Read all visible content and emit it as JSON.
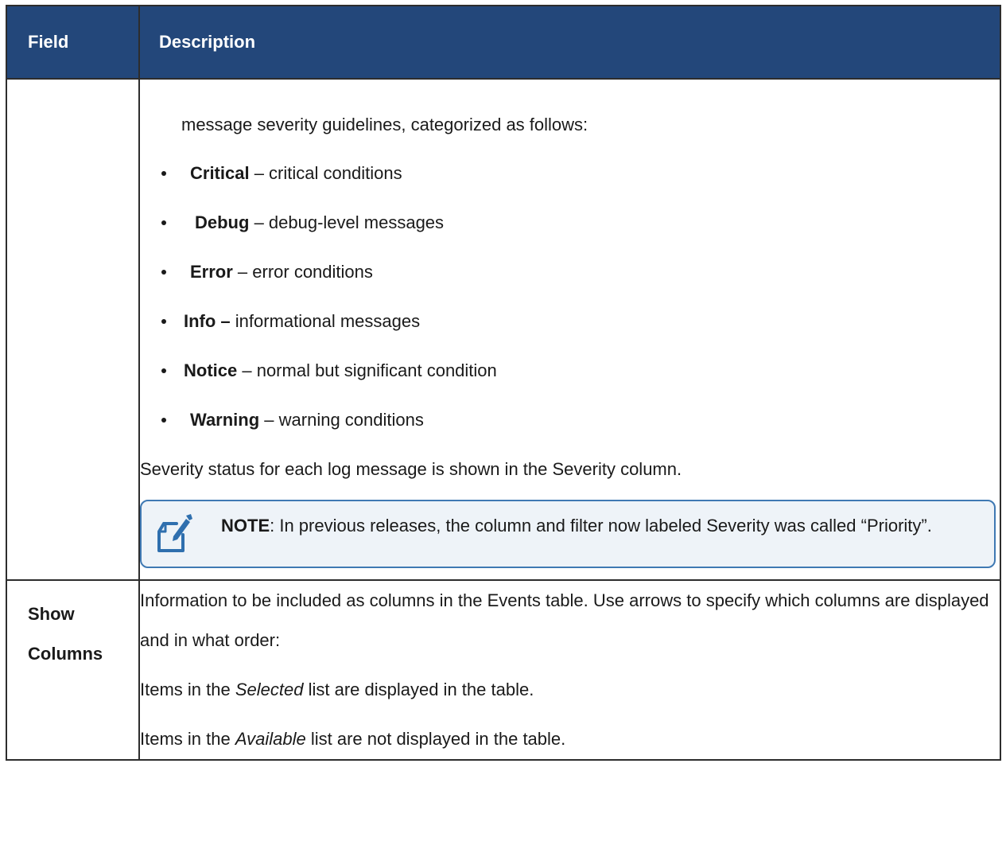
{
  "table": {
    "headers": {
      "field": "Field",
      "description": "Description"
    },
    "severity_row": {
      "field": "",
      "intro": "message severity guidelines, categorized as follows:",
      "levels": [
        {
          "term": "Critical",
          "text": " – critical conditions"
        },
        {
          "term": "Debug",
          "text": " – debug-level messages"
        },
        {
          "term": "Error",
          "text": " – error conditions"
        },
        {
          "term": "Info –",
          "text": " informational messages"
        },
        {
          "term": "Notice",
          "text": " – normal but significant condition"
        },
        {
          "term": "Warning",
          "text": " – warning conditions"
        }
      ],
      "summary": "Severity status for each log message is shown in the Severity column.",
      "note": {
        "icon": "note-pencil-icon",
        "label": "NOTE",
        "text": ":  In previous releases, the column and filter now labeled Severity was called “Priority”."
      }
    },
    "show_columns_row": {
      "field_line1": "Show",
      "field_line2": "Columns",
      "line1": "Information to be included as columns in the Events table. Use arrows to specify which columns are displayed and in what order:",
      "selected_pre": "Items in the ",
      "selected_em": "Selected",
      "selected_post": " list are displayed in the table.",
      "available_pre": "Items in the ",
      "available_em": "Available",
      "available_post": " list are not displayed in the table."
    }
  },
  "colors": {
    "header_bg": "#23477a",
    "note_bg": "#eef3f8",
    "note_border": "#3f79b3"
  }
}
